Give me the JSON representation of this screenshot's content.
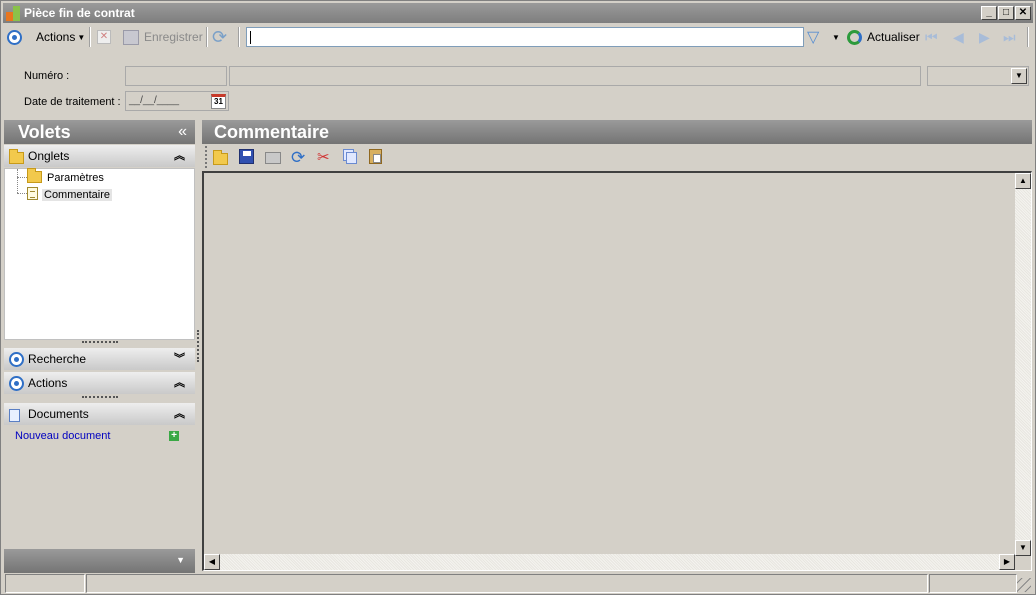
{
  "window": {
    "title": "Pièce fin de contrat",
    "minimize": "_",
    "maximize": "□",
    "close": "✕"
  },
  "toolbar": {
    "actions_label": "Actions",
    "save_label": "Enregistrer",
    "search_value": "",
    "refresh_label": "Actualiser"
  },
  "form": {
    "numero_label": "Numéro :",
    "numero_value": "",
    "numero_desc": "",
    "date_label": "Date de traitement :",
    "date_value": "__/__/____",
    "calendar_day": "31"
  },
  "left_pane": {
    "title": "Volets",
    "collapse_icon": "«",
    "sections": {
      "onglets": "Onglets",
      "recherche": "Recherche",
      "actions": "Actions",
      "documents": "Documents"
    },
    "tree_items": [
      "Paramètres",
      "Commentaire"
    ],
    "new_document_link": "Nouveau document"
  },
  "right_pane": {
    "title": "Commentaire"
  },
  "colors": {
    "window_bg": "#d4d0c8",
    "header_gray": "#7e7e7e",
    "accent_blue": "#2f6fc6",
    "link_blue": "#0000c0"
  },
  "icons": [
    "app-icon",
    "actions-circle-icon",
    "delete-icon",
    "save-icon",
    "refresh-icon",
    "filter-icon",
    "dropdown-arrow-icon",
    "refresh-circle-icon",
    "first-icon",
    "prev-icon",
    "next-icon",
    "last-icon",
    "calendar-icon",
    "folder-icon",
    "document-icon",
    "add-icon"
  ]
}
